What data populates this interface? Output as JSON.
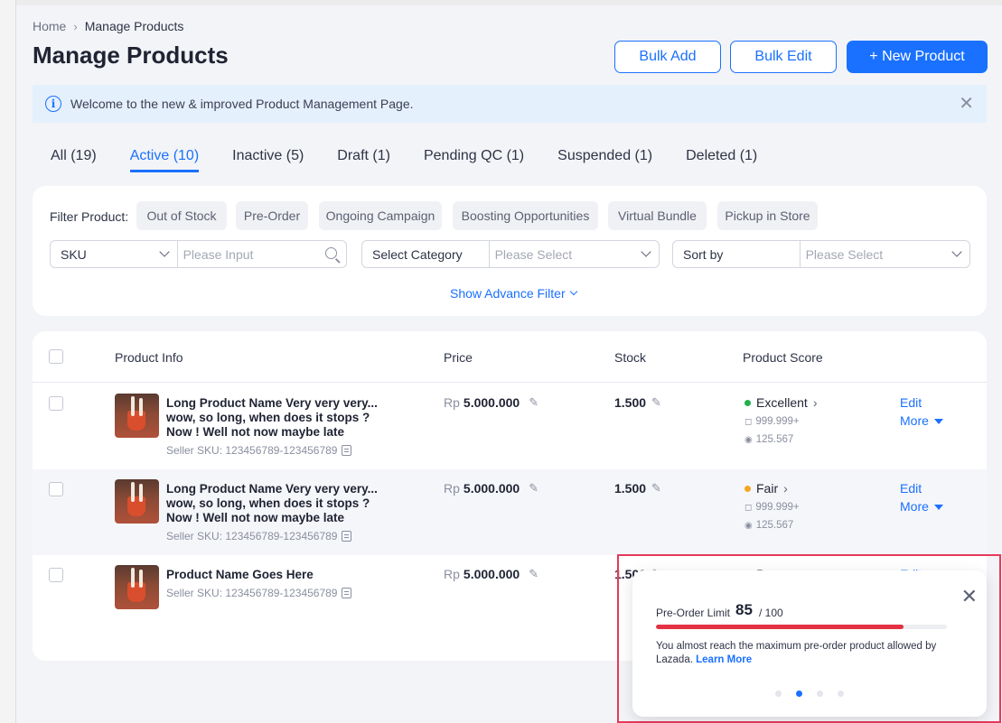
{
  "breadcrumb": {
    "home": "Home",
    "current": "Manage Products"
  },
  "page_title": "Manage Products",
  "header_buttons": {
    "bulk_add": "Bulk Add",
    "bulk_edit": "Bulk Edit",
    "new_product": "+ New Product"
  },
  "banner": {
    "text": "Welcome to the new & improved Product Management Page.",
    "info_icon": "info-icon",
    "close_icon": "close-icon"
  },
  "tabs": [
    {
      "label": "All (19)",
      "active": false
    },
    {
      "label": "Active (10)",
      "active": true
    },
    {
      "label": "Inactive (5)",
      "active": false
    },
    {
      "label": "Draft (1)",
      "active": false
    },
    {
      "label": "Pending QC (1)",
      "active": false
    },
    {
      "label": "Suspended (1)",
      "active": false
    },
    {
      "label": "Deleted (1)",
      "active": false
    }
  ],
  "filter": {
    "label": "Filter Product:",
    "chips": [
      "Out of Stock",
      "Pre-Order",
      "Ongoing Campaign",
      "Boosting Opportunities",
      "Virtual Bundle",
      "Pickup in Store"
    ],
    "sku_select": "SKU",
    "sku_placeholder": "Please Input",
    "category_label": "Select Category",
    "category_placeholder": "Please Select",
    "sort_label": "Sort by",
    "sort_placeholder": "Please Select",
    "advance_link": "Show Advance Filter"
  },
  "table": {
    "headers": {
      "product_info": "Product Info",
      "price": "Price",
      "stock": "Stock",
      "product_score": "Product Score"
    },
    "rows": [
      {
        "name_lines": [
          "Long Product Name Very very very...",
          "wow, so long, when does it stops ?",
          "Now ! Well not now maybe late"
        ],
        "sku": "Seller SKU: 123456789-123456789",
        "currency": "Rp",
        "price": "5.000.000",
        "stock": "1.500",
        "score": "Excellent",
        "score_color": "#22b14c",
        "sold": "999.999+",
        "views": "125.567",
        "edit": "Edit",
        "more": "More"
      },
      {
        "name_lines": [
          "Long Product Name Very very very...",
          "wow, so long, when does it stops ?",
          "Now ! Well not now maybe late"
        ],
        "sku": "Seller SKU: 123456789-123456789",
        "currency": "Rp",
        "price": "5.000.000",
        "stock": "1.500",
        "score": "Fair",
        "score_color": "#f5a623",
        "sold": "999.999+",
        "views": "125.567",
        "edit": "Edit",
        "more": "More"
      },
      {
        "name_lines": [
          "Product Name Goes Here"
        ],
        "sku": "Seller SKU: 123456789-123456789",
        "currency": "Rp",
        "price": "5.000.000",
        "stock": "1.500",
        "score": "Poor",
        "score_color": "#e43144",
        "edit": "Edit"
      }
    ]
  },
  "popup": {
    "label": "Pre-Order Limit",
    "value": "85",
    "max": "/ 100",
    "progress": 0.85,
    "bar_color": "#e43144",
    "message": "You almost reach the maximum pre-order product allowed by Lazada.",
    "link": "Learn More",
    "dots_total": 4,
    "dots_active_index": 1
  },
  "colors": {
    "accent": "#1a71ff",
    "highlight_border": "#e6395a"
  }
}
